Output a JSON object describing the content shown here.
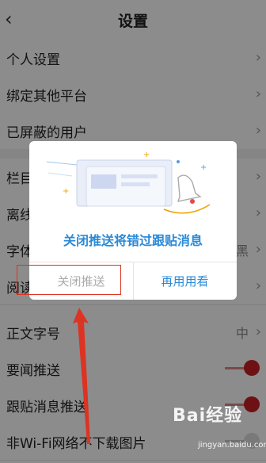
{
  "header": {
    "back_icon": "chevron-left-icon",
    "title": "设置"
  },
  "rows": [
    {
      "label": "个人设置"
    },
    {
      "label": "绑定其他平台"
    },
    {
      "label": "已屏蔽的用户"
    },
    {
      "label": "栏目"
    },
    {
      "label": "离线"
    },
    {
      "label": "字体",
      "value": "黑"
    },
    {
      "label": "阅读"
    },
    {
      "label": "正文字号",
      "value": "中"
    },
    {
      "label": "要闻推送",
      "toggle": true
    },
    {
      "label": "跟贴消息推送",
      "toggle": true
    },
    {
      "label": "非Wi-Fi网络不下载图片",
      "toggle": false
    }
  ],
  "dialog": {
    "message": "关闭推送将错过跟贴消息",
    "cancel_label": "关闭推送",
    "confirm_label": "再用用看"
  },
  "colors": {
    "accent_blue": "#2a8ad8",
    "toggle_red": "#c81f26",
    "annotation_red": "#d32"
  },
  "watermark": {
    "text": "Bai经验",
    "url": "jingyan.baidu.com"
  }
}
